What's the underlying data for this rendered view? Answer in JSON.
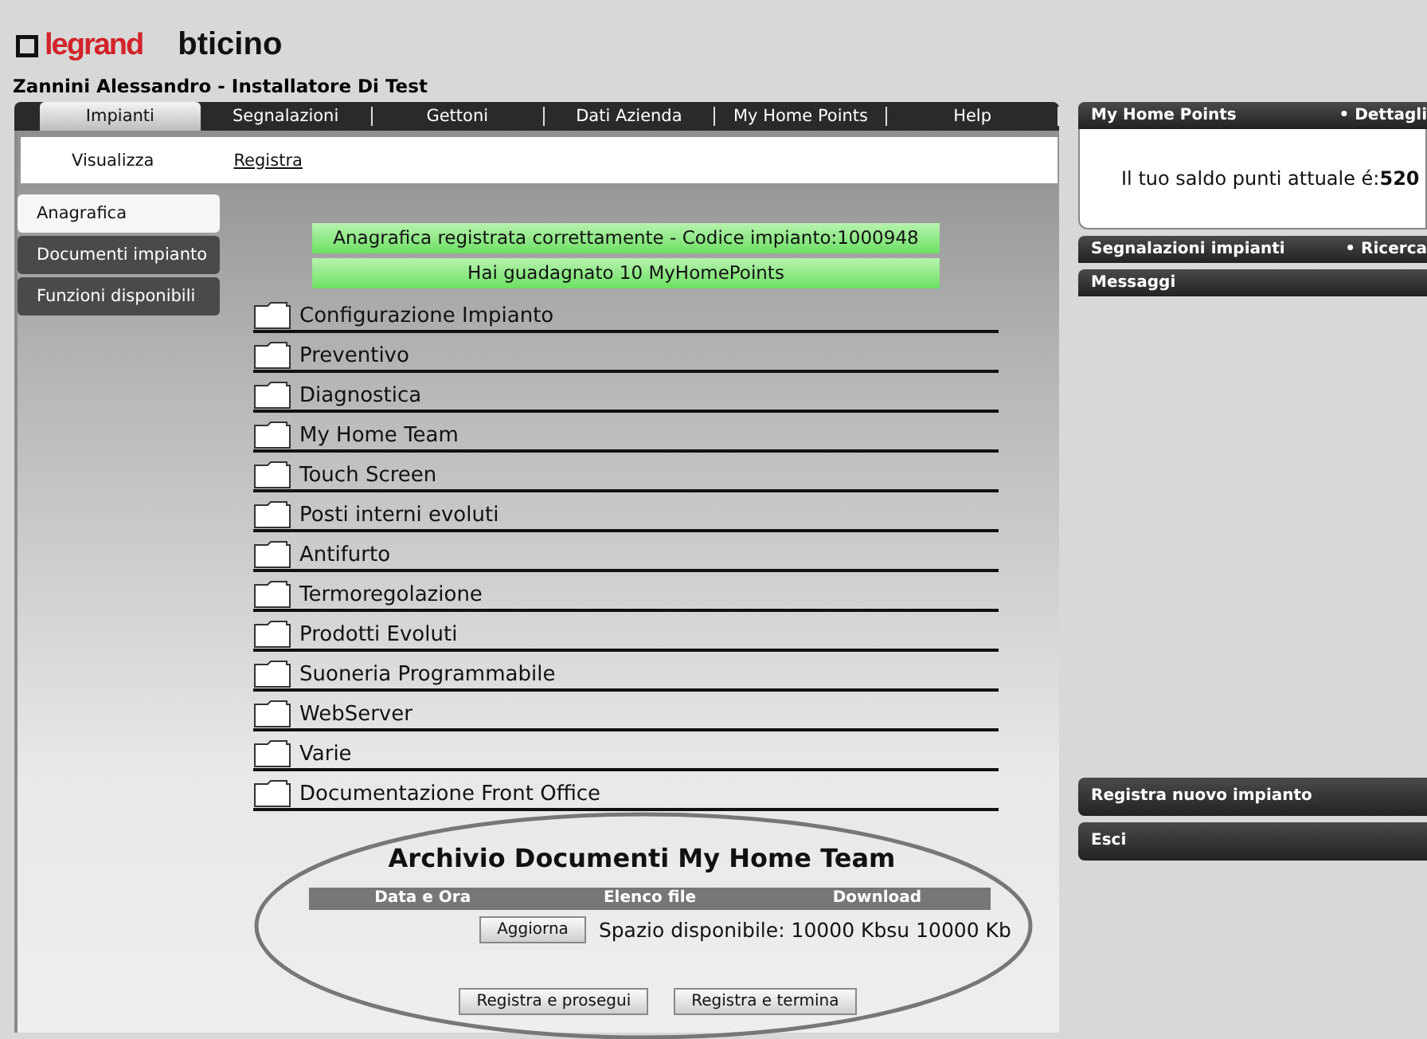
{
  "logos": [
    "legrand",
    "bticino"
  ],
  "user": "Zannini Alessandro - Installatore Di Test",
  "tabs": [
    {
      "label": "Impianti",
      "selected": true
    },
    {
      "label": "Segnalazioni",
      "selected": false
    },
    {
      "label": "Gettoni",
      "selected": false
    },
    {
      "label": "Dati Azienda",
      "selected": false
    },
    {
      "label": "My Home Points",
      "selected": false
    },
    {
      "label": "Help",
      "selected": false
    }
  ],
  "subnav": [
    {
      "label": "Visualizza",
      "selected": false
    },
    {
      "label": "Registra",
      "selected": true
    }
  ],
  "sidebar": {
    "items": [
      {
        "label": "Anagrafica",
        "selected": true
      },
      {
        "label": "Documenti impianto",
        "selected": false
      },
      {
        "label": "Funzioni disponibili",
        "selected": false
      }
    ]
  },
  "messages": [
    "Anagrafica registrata correttamente - Codice impianto:1000948",
    "Hai guadagnato 10 MyHomePoints"
  ],
  "folders": [
    "Configurazione Impianto",
    "Preventivo",
    "Diagnostica",
    "My Home Team",
    "Touch Screen",
    "Posti interni evoluti",
    "Antifurto",
    "Termoregolazione",
    "Prodotti Evoluti",
    "Suoneria Programmabile",
    "WebServer",
    "Varie",
    "Documentazione Front Office"
  ],
  "archive": {
    "title": "Archivio Documenti My Home Team",
    "columns": [
      "Data e Ora",
      "Elenco file",
      "Download"
    ],
    "refresh_button": "Aggiorna",
    "space": "Spazio disponibile: 10000 Kbsu 10000 Kb"
  },
  "buttons": [
    "Registra e prosegui",
    "Registra e termina"
  ],
  "right": {
    "points": {
      "title": "My Home Points",
      "link": "• Dettagli",
      "text": "Il tuo saldo punti attuale é:**520**"
    },
    "panels": [
      {
        "title": "Segnalazioni impianti",
        "link": "• Ricerca"
      },
      {
        "title": "Messaggi"
      }
    ],
    "bottom": [
      "Registra nuovo impianto",
      "Esci"
    ]
  }
}
